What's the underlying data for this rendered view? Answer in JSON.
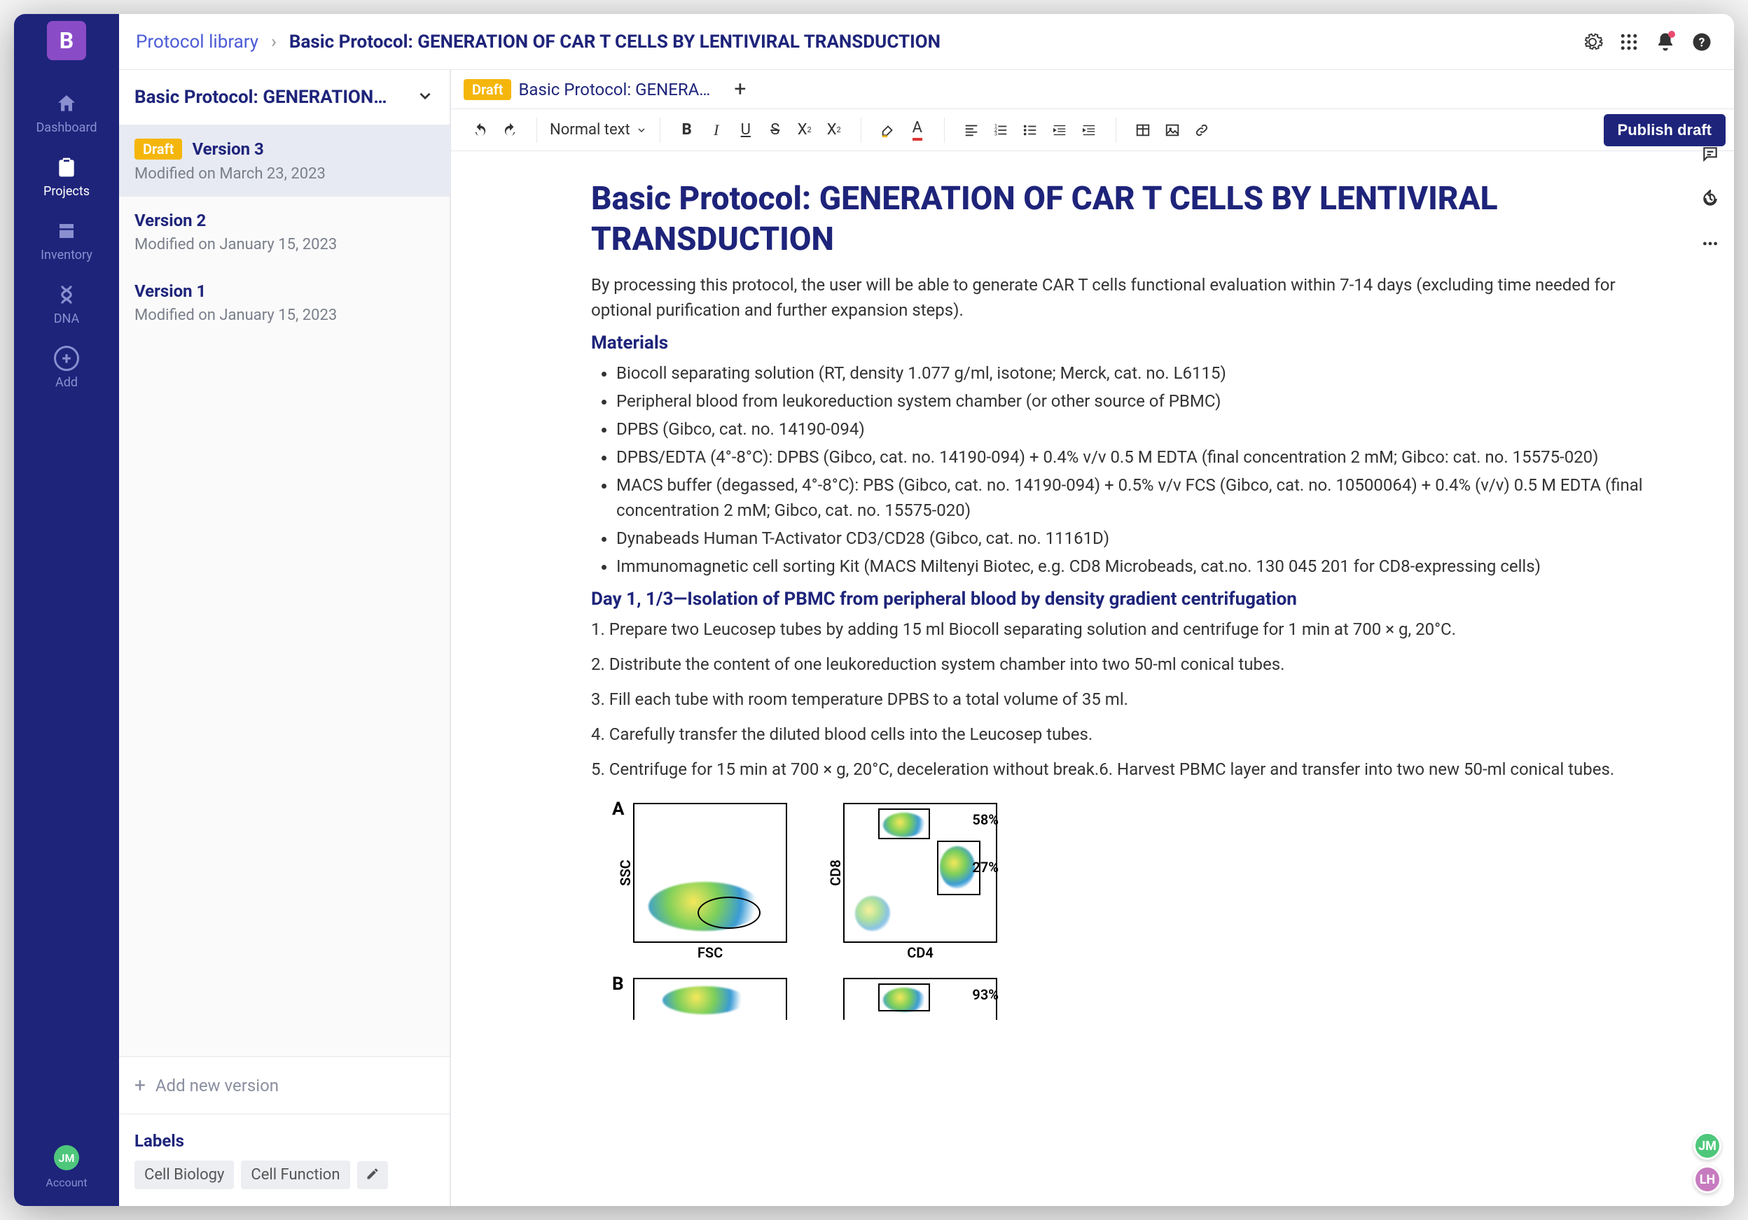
{
  "logo_letter": "B",
  "nav": [
    {
      "label": "Dashboard",
      "icon": "home"
    },
    {
      "label": "Projects",
      "icon": "clipboard",
      "active": true
    },
    {
      "label": "Inventory",
      "icon": "box"
    },
    {
      "label": "DNA",
      "icon": "dna"
    },
    {
      "label": "Add",
      "icon": "add"
    }
  ],
  "account_label": "Account",
  "account_initials": "JM",
  "breadcrumb": {
    "root": "Protocol library",
    "current": "Basic Protocol: GENERATION OF CAR T CELLS BY LENTIVIRAL TRANSDUCTION"
  },
  "sidebar": {
    "title": "Basic Protocol: GENERATION…",
    "versions": [
      {
        "badge": "Draft",
        "name": "Version 3",
        "modified": "Modified on March 23, 2023",
        "selected": true
      },
      {
        "name": "Version 2",
        "modified": "Modified on January 15, 2023"
      },
      {
        "name": "Version 1",
        "modified": "Modified on January 15, 2023"
      }
    ],
    "add_version": "Add new version",
    "labels_title": "Labels",
    "labels": [
      "Cell Biology",
      "Cell Function"
    ]
  },
  "editor_tab": {
    "badge": "Draft",
    "title": "Basic Protocol: GENERA…"
  },
  "toolbar": {
    "text_style": "Normal text",
    "publish": "Publish draft"
  },
  "doc": {
    "title": "Basic Protocol: GENERATION OF CAR T CELLS BY LENTIVIRAL TRANSDUCTION",
    "intro": "By processing this protocol, the user will be able to generate CAR T cells functional evaluation within 7-14 days (excluding time needed for optional purification and further expansion steps).",
    "materials_h": "Materials",
    "materials": [
      "Biocoll separating solution (RT, density 1.077 g/ml, isotone; Merck, cat. no. L6115)",
      "Peripheral blood from leukoreduction system chamber (or other source of PBMC)",
      "DPBS (Gibco, cat. no. 14190-094)",
      "DPBS/EDTA (4°-8°C): DPBS (Gibco, cat. no. 14190-094) + 0.4% v/v 0.5 M EDTA (final concentration 2 mM; Gibco: cat. no. 15575-020)",
      "MACS buffer (degassed, 4°-8°C): PBS (Gibco, cat. no. 14190-094) + 0.5% v/v FCS (Gibco, cat. no. 10500064) + 0.4% (v/v) 0.5 M EDTA (final concentration 2 mM; Gibco, cat. no. 15575-020)",
      "Dynabeads Human T-Activator CD3/CD28 (Gibco, cat. no. 11161D)",
      "Immunomagnetic cell sorting Kit (MACS Miltenyi Biotec, e.g. CD8 Microbeads, cat.no. 130 045 201 for CD8-expressing cells)"
    ],
    "day1_h": "Day 1, 1/3—Isolation of PBMC from peripheral blood by density gradient centrifugation",
    "steps": [
      "1. Prepare two Leucosep tubes by adding 15 ml Biocoll separating solution and centrifuge for 1 min at 700 × g, 20°C.",
      "2. Distribute the content of one leukoreduction system chamber into two 50-ml conical tubes.",
      "3. Fill each tube with room temperature DPBS to a total volume of 35 ml.",
      "4. Carefully transfer the diluted blood cells into the Leucosep tubes.",
      "5. Centrifuge for 15 min at 700 × g, 20°C, deceleration without break.6. Harvest PBMC layer and transfer into two new 50-ml conical tubes."
    ]
  },
  "figure": {
    "panel_a": "A",
    "panel_b": "B",
    "ssc": "SSC",
    "fsc": "FSC",
    "cd8": "CD8",
    "cd4": "CD4",
    "pct58": "58%",
    "pct27": "27%",
    "pct93": "93%"
  },
  "presence": [
    {
      "initials": "JM",
      "cls": "pa-jm"
    },
    {
      "initials": "LH",
      "cls": "pa-lh"
    }
  ]
}
